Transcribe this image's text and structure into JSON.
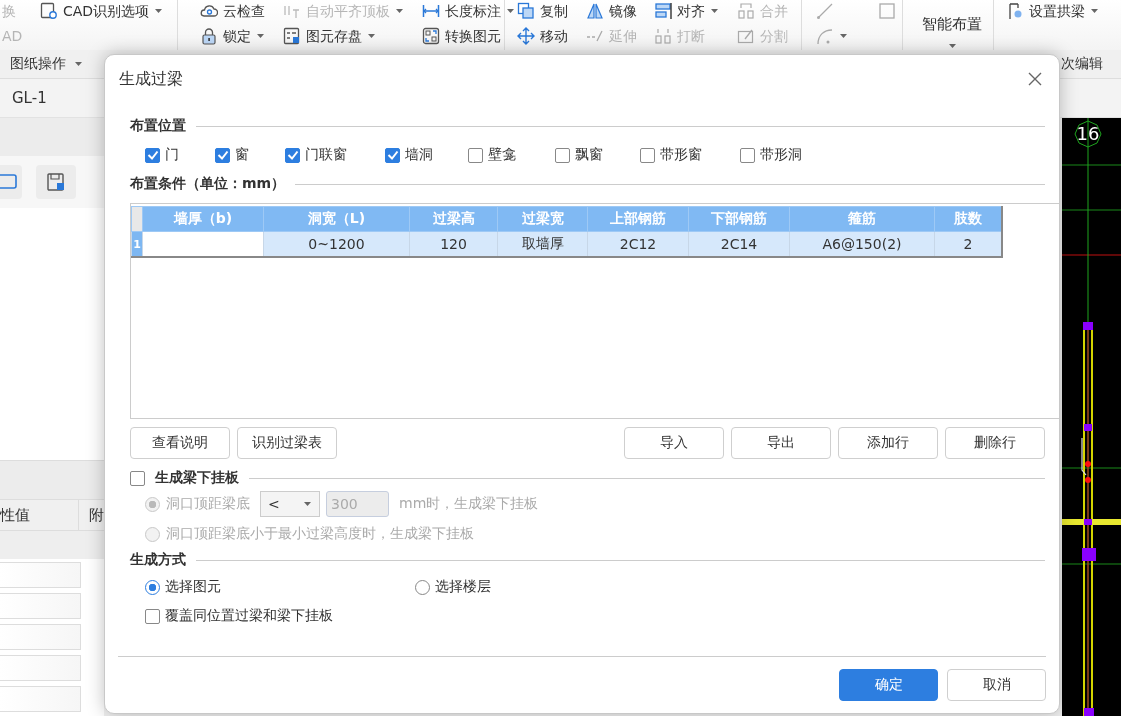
{
  "ribbon": {
    "groups": [
      {
        "items": [
          {
            "label": "换",
            "disabled": true
          },
          {
            "label": "AD",
            "disabled": true
          },
          {
            "label": "CAD识别选项",
            "dropdown": true
          }
        ],
        "label": "图纸操作"
      },
      {
        "items": [
          {
            "label": "云检查"
          },
          {
            "label": "锁定",
            "dropdown": true
          },
          {
            "label": "自动平齐顶板",
            "disabled": true,
            "dropdown": true
          },
          {
            "label": "图元存盘",
            "dropdown": true
          },
          {
            "label": "长度标注",
            "dropdown": true
          },
          {
            "label": "转换图元"
          }
        ]
      },
      {
        "items": [
          {
            "label": "复制"
          },
          {
            "label": "移动"
          },
          {
            "label": "镜像"
          },
          {
            "label": "延伸",
            "disabled": true
          },
          {
            "label": "对齐",
            "dropdown": true
          },
          {
            "label": "打断",
            "disabled": true
          },
          {
            "label": "合并",
            "disabled": true
          },
          {
            "label": "分割",
            "disabled": true
          }
        ]
      },
      {
        "items": [
          {
            "disabled": true
          },
          {
            "disabled": true,
            "dropdown": true
          },
          {
            "disabled": true
          }
        ]
      },
      {
        "items": [
          {
            "label": "智能布置",
            "dropdown": true
          }
        ]
      },
      {
        "items": [
          {
            "label": "设置拱梁",
            "dropdown": true
          }
        ],
        "label": "次编辑"
      }
    ]
  },
  "tab": "GL-1",
  "properties": {
    "columns": [
      "性值",
      "附"
    ]
  },
  "canvas": {
    "labels": [
      "16"
    ]
  },
  "dialog": {
    "title": "生成过梁",
    "placement": {
      "title": "布置位置",
      "options": [
        {
          "label": "门",
          "checked": true
        },
        {
          "label": "窗",
          "checked": true
        },
        {
          "label": "门联窗",
          "checked": true
        },
        {
          "label": "墙洞",
          "checked": true
        },
        {
          "label": "壁龛",
          "checked": false
        },
        {
          "label": "飘窗",
          "checked": false
        },
        {
          "label": "带形窗",
          "checked": false
        },
        {
          "label": "带形洞",
          "checked": false
        }
      ]
    },
    "conditions": {
      "title": "布置条件（单位：mm）",
      "columns": [
        "墙厚（b)",
        "洞宽（L)",
        "过梁高",
        "过梁宽",
        "上部钢筋",
        "下部钢筋",
        "箍筋",
        "肢数"
      ],
      "rows": [
        {
          "number": "1",
          "selected": true,
          "cells": [
            {
              "editing": true
            },
            {
              "text": "0~1200"
            },
            {
              "text": "120"
            },
            {
              "text": "取墙厚"
            },
            {
              "text": "2C12"
            },
            {
              "text": "2C14"
            },
            {
              "text": "A6@150(2)"
            },
            {
              "text": "2"
            }
          ]
        }
      ],
      "left_buttons": [
        "查看说明",
        "识别过梁表"
      ],
      "right_buttons": [
        "导入",
        "导出",
        "添加行",
        "删除行"
      ]
    },
    "hanging": {
      "title": "生成梁下挂板",
      "checked": false,
      "options": [
        {
          "kind": "threshold",
          "label": "洞口顶距梁底",
          "selected": true,
          "disabled": true,
          "operator": "<",
          "value": "300",
          "suffix": "mm时，生成梁下挂板"
        },
        {
          "kind": "plain",
          "label": "洞口顶距梁底小于最小过梁高度时，生成梁下挂板",
          "selected": false,
          "disabled": true
        }
      ]
    },
    "method": {
      "title": "生成方式",
      "options": [
        {
          "label": "选择图元",
          "selected": true
        },
        {
          "label": "选择楼层",
          "selected": false
        }
      ],
      "overwrite": {
        "label": "覆盖同位置过梁和梁下挂板",
        "checked": false
      }
    },
    "buttons": [
      {
        "label": "确定",
        "primary": true
      },
      {
        "label": "取消",
        "primary": false
      }
    ]
  }
}
